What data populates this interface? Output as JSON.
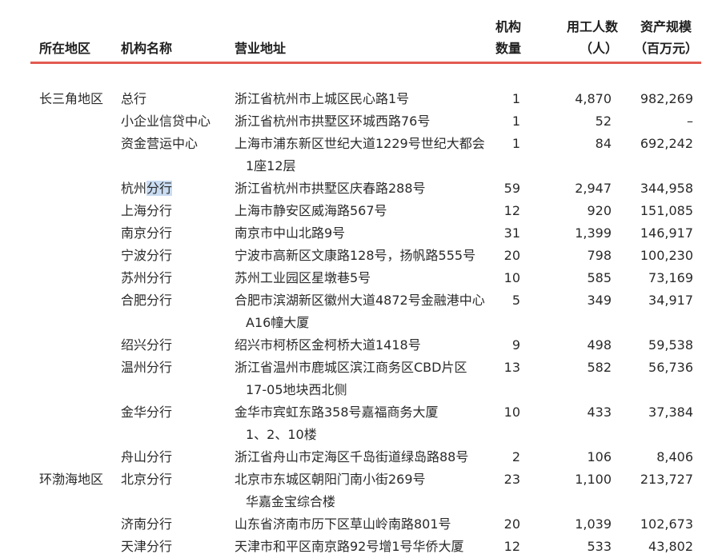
{
  "header": {
    "region": "所在地区",
    "name": "机构名称",
    "address": "营业地址",
    "count_line1": "机构",
    "count_line2": "数量",
    "employees_line1": "用工人数",
    "employees_line2": "（人）",
    "assets_line1": "资产规模",
    "assets_line2": "（百万元）"
  },
  "accent_color": "#e25b52",
  "highlight_color": "#c9dcf2",
  "rows": [
    {
      "region": "长三角地区",
      "name": "总行",
      "name_highlight": "",
      "address": [
        "浙江省杭州市上城区民心路1号"
      ],
      "count": "1",
      "employees": "4,870",
      "assets": "982,269"
    },
    {
      "region": "",
      "name": "小企业信贷中心",
      "name_highlight": "",
      "address": [
        "浙江省杭州市拱墅区环城西路76号"
      ],
      "count": "1",
      "employees": "52",
      "assets": "–"
    },
    {
      "region": "",
      "name": "资金营运中心",
      "name_highlight": "",
      "address": [
        "上海市浦东新区世纪大道1229号世纪大都会",
        "1座12层"
      ],
      "count": "1",
      "employees": "84",
      "assets": "692,242"
    },
    {
      "region": "",
      "name": "杭州",
      "name_highlight": "分行",
      "address": [
        "浙江省杭州市拱墅区庆春路288号"
      ],
      "count": "59",
      "employees": "2,947",
      "assets": "344,958"
    },
    {
      "region": "",
      "name": "上海分行",
      "name_highlight": "",
      "address": [
        "上海市静安区威海路567号"
      ],
      "count": "12",
      "employees": "920",
      "assets": "151,085"
    },
    {
      "region": "",
      "name": "南京分行",
      "name_highlight": "",
      "address": [
        "南京市中山北路9号"
      ],
      "count": "31",
      "employees": "1,399",
      "assets": "146,917"
    },
    {
      "region": "",
      "name": "宁波分行",
      "name_highlight": "",
      "address": [
        "宁波市高新区文康路128号，扬帆路555号"
      ],
      "count": "20",
      "employees": "798",
      "assets": "100,230"
    },
    {
      "region": "",
      "name": "苏州分行",
      "name_highlight": "",
      "address": [
        "苏州工业园区星墩巷5号"
      ],
      "count": "10",
      "employees": "585",
      "assets": "73,169"
    },
    {
      "region": "",
      "name": "合肥分行",
      "name_highlight": "",
      "address": [
        "合肥市滨湖新区徽州大道4872号金融港中心",
        "A16幢大厦"
      ],
      "count": "5",
      "employees": "349",
      "assets": "34,917"
    },
    {
      "region": "",
      "name": "绍兴分行",
      "name_highlight": "",
      "address": [
        "绍兴市柯桥区金柯桥大道1418号"
      ],
      "count": "9",
      "employees": "498",
      "assets": "59,538"
    },
    {
      "region": "",
      "name": "温州分行",
      "name_highlight": "",
      "address": [
        "浙江省温州市鹿城区滨江商务区CBD片区",
        "17-05地块西北侧"
      ],
      "count": "13",
      "employees": "582",
      "assets": "56,736"
    },
    {
      "region": "",
      "name": "金华分行",
      "name_highlight": "",
      "address": [
        "金华市宾虹东路358号嘉福商务大厦",
        "1、2、10楼"
      ],
      "count": "10",
      "employees": "433",
      "assets": "37,384"
    },
    {
      "region": "",
      "name": "舟山分行",
      "name_highlight": "",
      "address": [
        "浙江省舟山市定海区千岛街道绿岛路88号"
      ],
      "count": "2",
      "employees": "106",
      "assets": "8,406"
    },
    {
      "region": "环渤海地区",
      "name": "北京分行",
      "name_highlight": "",
      "address": [
        "北京市东城区朝阳门南小街269号",
        "华嘉金宝综合楼"
      ],
      "count": "23",
      "employees": "1,100",
      "assets": "213,727"
    },
    {
      "region": "",
      "name": "济南分行",
      "name_highlight": "",
      "address": [
        "山东省济南市历下区草山岭南路801号"
      ],
      "count": "20",
      "employees": "1,039",
      "assets": "102,673"
    },
    {
      "region": "",
      "name": "天津分行",
      "name_highlight": "",
      "address": [
        "天津市和平区南京路92号增1号华侨大厦"
      ],
      "count": "12",
      "employees": "533",
      "assets": "43,802"
    }
  ]
}
